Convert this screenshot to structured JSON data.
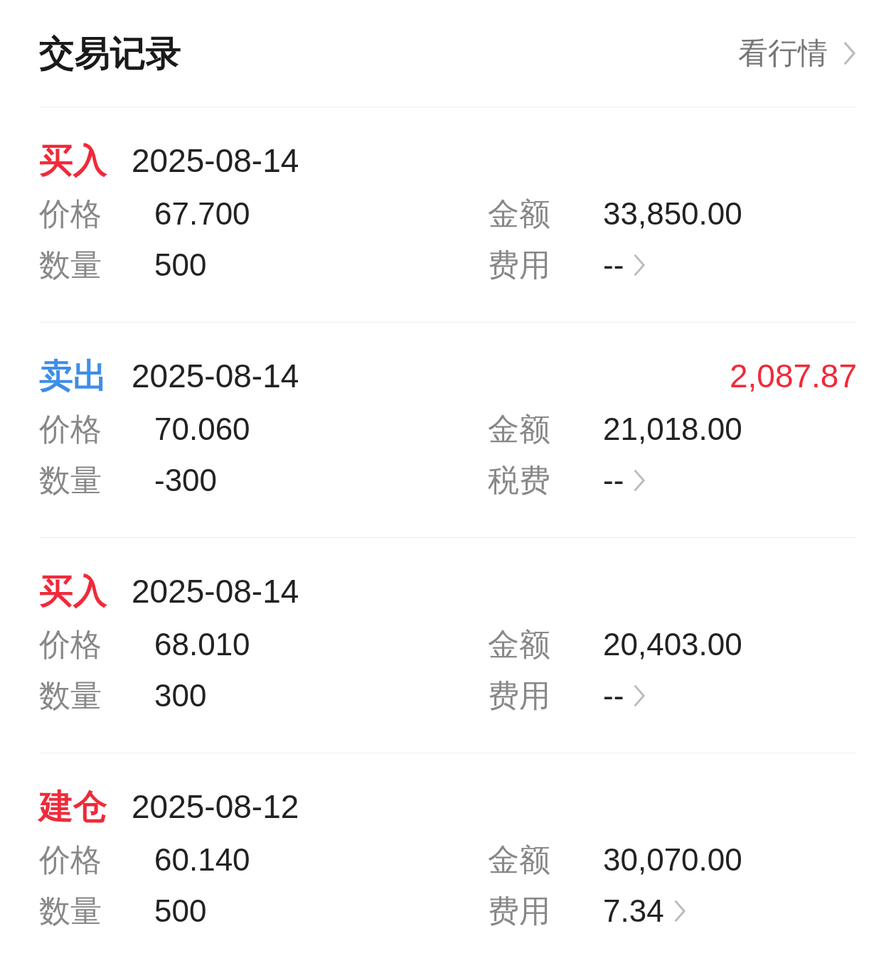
{
  "header": {
    "title": "交易记录",
    "link": "看行情"
  },
  "records": [
    {
      "kind": "buy",
      "action": "买入",
      "date": "2025-08-14",
      "price_label": "价格",
      "price": "67.700",
      "amount_label": "金额",
      "amount": "33,850.00",
      "qty_label": "数量",
      "qty": "500",
      "fee_label": "费用",
      "fee": "--"
    },
    {
      "kind": "sell",
      "action": "卖出",
      "date": "2025-08-14",
      "profit": "2,087.87",
      "price_label": "价格",
      "price": "70.060",
      "amount_label": "金额",
      "amount": "21,018.00",
      "qty_label": "数量",
      "qty": "-300",
      "fee_label": "税费",
      "fee": "--"
    },
    {
      "kind": "buy",
      "action": "买入",
      "date": "2025-08-14",
      "price_label": "价格",
      "price": "68.010",
      "amount_label": "金额",
      "amount": "20,403.00",
      "qty_label": "数量",
      "qty": "300",
      "fee_label": "费用",
      "fee": "--"
    },
    {
      "kind": "open",
      "action": "建仓",
      "date": "2025-08-12",
      "price_label": "价格",
      "price": "60.140",
      "amount_label": "金额",
      "amount": "30,070.00",
      "qty_label": "数量",
      "qty": "500",
      "fee_label": "费用",
      "fee": "7.34"
    }
  ]
}
